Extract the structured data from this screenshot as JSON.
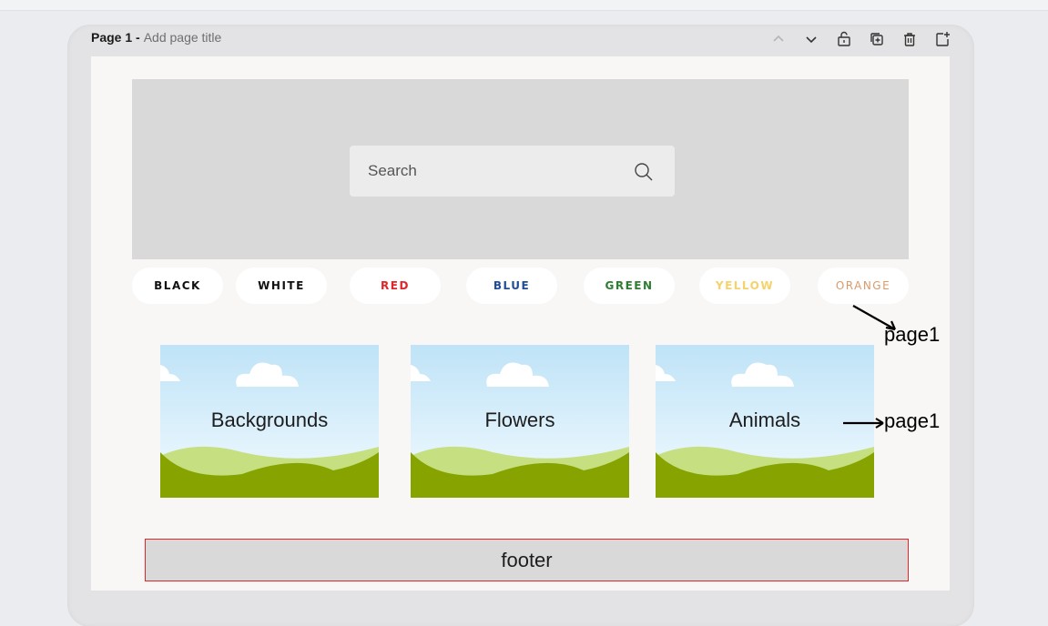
{
  "page": {
    "number_label": "Page 1 -",
    "title_placeholder": "Add page title"
  },
  "toolbar": {
    "icons": [
      "chevron-up-icon",
      "chevron-down-icon",
      "lock-icon",
      "duplicate-icon",
      "trash-icon",
      "add-page-icon"
    ]
  },
  "search": {
    "placeholder": "Search",
    "icon": "search-icon"
  },
  "colors": {
    "items": [
      {
        "label": "BLACK",
        "color": "#111111"
      },
      {
        "label": "WHITE",
        "color": "#111111"
      },
      {
        "label": "RED",
        "color": "#e0262b"
      },
      {
        "label": "BLUE",
        "color": "#1f4e96"
      },
      {
        "label": "GREEN",
        "color": "#2e7d32"
      },
      {
        "label": "YELLOW",
        "color": "#f5d36b"
      },
      {
        "label": "ORANGE",
        "color": "#d99a6a"
      }
    ]
  },
  "categories": {
    "items": [
      {
        "label": "Backgrounds"
      },
      {
        "label": "Flowers"
      },
      {
        "label": "Animals"
      }
    ]
  },
  "annotations": {
    "colors_note": "page1",
    "categories_note": "page1"
  },
  "footer": {
    "label": "footer"
  },
  "theme": {
    "hero_bg": "#d9d9d9",
    "footer_border": "#e0262b",
    "grass_dark": "#86a300",
    "grass_light": "#c6df80",
    "sky_top": "#bfe3f7"
  }
}
